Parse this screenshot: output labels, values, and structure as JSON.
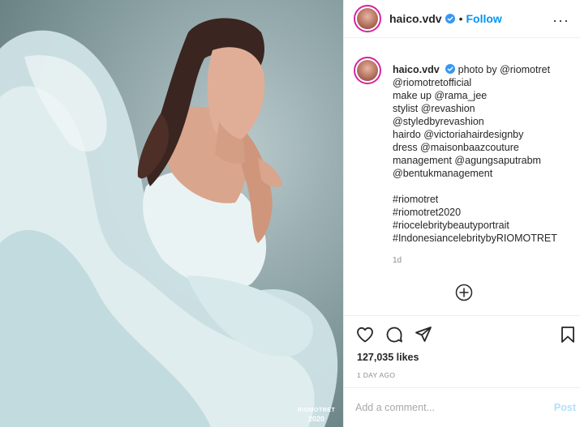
{
  "photo": {
    "watermark_line1": "RIOMOTRET",
    "watermark_line2": "2020"
  },
  "header": {
    "username": "haico.vdv",
    "separator": "•",
    "follow_label": "Follow",
    "more_glyph": "···"
  },
  "caption": {
    "username": "haico.vdv",
    "lines": [
      "photo by @riomotret",
      "@riomotretofficial",
      "make up @rama_jee",
      "stylist @revashion",
      "@styledbyrevashion",
      "hairdo @victoriahairdesignby",
      "dress @maisonbaazcouture",
      "management @agungsaputrabm",
      "@bentukmanagement"
    ],
    "hashtags": [
      "#riomotret",
      "#riomotret2020",
      "#riocelebritybeautyportrait",
      "#IndonesiancelebritybyRIOMOTRET"
    ],
    "time": "1d"
  },
  "post": {
    "likes": "127,035 likes",
    "posted": "1 DAY AGO"
  },
  "comment": {
    "placeholder": "Add a comment...",
    "post_label": "Post"
  },
  "colors": {
    "link": "#0095f6",
    "verified": "#3897f0",
    "post_disabled": "#b2dffc",
    "muted": "#8e8e8e"
  },
  "icons": [
    "verified-icon",
    "more-options-icon",
    "load-more-icon",
    "heart-icon",
    "comment-icon",
    "share-icon",
    "bookmark-icon"
  ]
}
